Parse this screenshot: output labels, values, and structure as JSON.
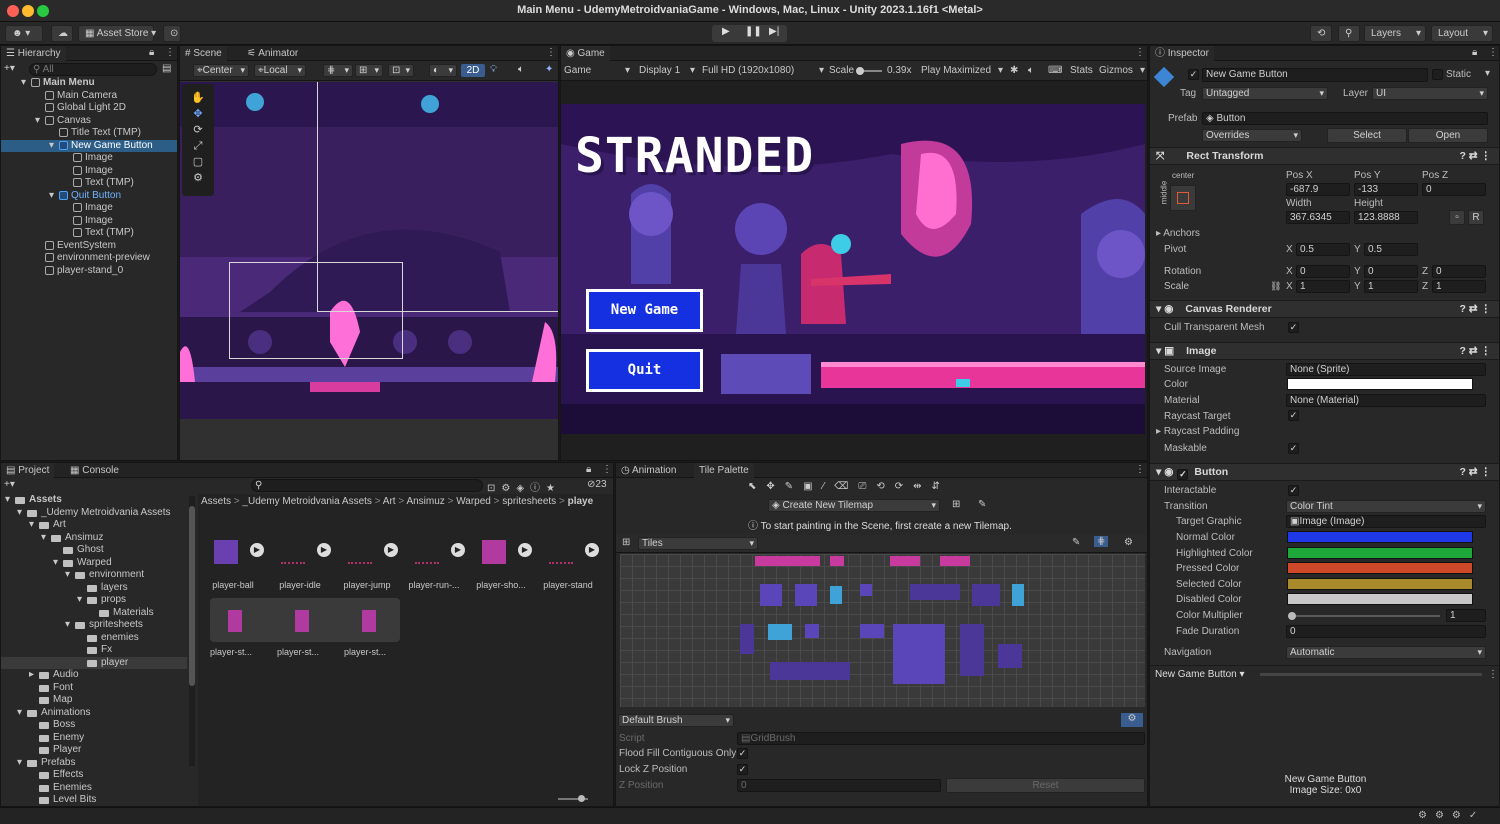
{
  "window": {
    "title": "Main Menu - UdemyMetroidvaniaGame - Windows, Mac, Linux - Unity 2023.1.16f1 <Metal>"
  },
  "toolbar": {
    "asset_store": "Asset Store",
    "layers": "Layers",
    "layout": "Layout"
  },
  "hierarchy": {
    "tab": "Hierarchy",
    "search_placeholder": "All",
    "items": [
      {
        "label": "Main Menu"
      },
      {
        "label": "Main Camera"
      },
      {
        "label": "Global Light 2D"
      },
      {
        "label": "Canvas"
      },
      {
        "label": "Title Text (TMP)"
      },
      {
        "label": "New Game Button"
      },
      {
        "label": "Image"
      },
      {
        "label": "Image"
      },
      {
        "label": "Text (TMP)"
      },
      {
        "label": "Quit Button"
      },
      {
        "label": "Image"
      },
      {
        "label": "Image"
      },
      {
        "label": "Text (TMP)"
      },
      {
        "label": "EventSystem"
      },
      {
        "label": "environment-preview"
      },
      {
        "label": "player-stand_0"
      }
    ]
  },
  "scene": {
    "tabs": [
      "Scene",
      "Animator"
    ],
    "pivot": "Center",
    "space": "Local",
    "mode2d": "2D"
  },
  "game": {
    "tab": "Game",
    "display_dd": "Game",
    "display": "Display 1",
    "resolution": "Full HD (1920x1080)",
    "scale_label": "Scale",
    "scale": "0.39x",
    "play_mode": "Play Maximized",
    "stats": "Stats",
    "gizmos": "Gizmos",
    "title": "STRANDED",
    "new_game": "New Game",
    "quit": "Quit"
  },
  "project": {
    "tabs": [
      "Project",
      "Console"
    ],
    "badge": "23",
    "tree": [
      {
        "label": "Assets"
      },
      {
        "label": "_Udemy Metroidvania Assets"
      },
      {
        "label": "Art"
      },
      {
        "label": "Ansimuz"
      },
      {
        "label": "Ghost"
      },
      {
        "label": "Warped"
      },
      {
        "label": "environment"
      },
      {
        "label": "layers"
      },
      {
        "label": "props"
      },
      {
        "label": "Materials"
      },
      {
        "label": "spritesheets"
      },
      {
        "label": "enemies"
      },
      {
        "label": "Fx"
      },
      {
        "label": "player"
      },
      {
        "label": "Audio"
      },
      {
        "label": "Font"
      },
      {
        "label": "Map"
      },
      {
        "label": "Animations"
      },
      {
        "label": "Boss"
      },
      {
        "label": "Enemy"
      },
      {
        "label": "Player"
      },
      {
        "label": "Prefabs"
      },
      {
        "label": "Effects"
      },
      {
        "label": "Enemies"
      },
      {
        "label": "Level Bits"
      }
    ],
    "breadcrumb": [
      "Assets",
      "_Udemy Metroidvania Assets",
      "Art",
      "Ansimuz",
      "Warped",
      "spritesheets",
      "playe"
    ],
    "assets": [
      "player-ball",
      "player-idle",
      "player-jump",
      "player-run-...",
      "player-sho...",
      "player-stand"
    ],
    "sub_assets": [
      "player-st...",
      "player-st...",
      "player-st..."
    ]
  },
  "palette": {
    "tabs": [
      "Animation",
      "Tile Palette"
    ],
    "create_tilemap": "Create New Tilemap",
    "hint": "To start painting in the Scene, first create a new Tilemap.",
    "tiles_dd": "Tiles",
    "brush": "Default Brush",
    "script_label": "Script",
    "script_value": "GridBrush",
    "flood": "Flood Fill Contiguous Only",
    "lockz": "Lock Z Position",
    "zpos": "Z Position",
    "zpos_value": "0",
    "reset": "Reset"
  },
  "inspector": {
    "tab": "Inspector",
    "object_name": "New Game Button",
    "static": "Static",
    "tag_label": "Tag",
    "tag": "Untagged",
    "layer_label": "Layer",
    "layer": "UI",
    "prefab_label": "Prefab",
    "prefab": "Button",
    "overrides": "Overrides",
    "select": "Select",
    "open": "Open",
    "rect": {
      "title": "Rect Transform",
      "anchor_h": "center",
      "anchor_v": "middle",
      "posx_label": "Pos X",
      "posy_label": "Pos Y",
      "posz_label": "Pos Z",
      "posx": "-687.9",
      "posy": "-133",
      "posz": "0",
      "width_label": "Width",
      "height_label": "Height",
      "width": "367.6345",
      "height": "123.8888",
      "r": "R",
      "anchors": "Anchors",
      "pivot": "Pivot",
      "pivot_x": "0.5",
      "pivot_y": "0.5",
      "rotation": "Rotation",
      "rot_x": "0",
      "rot_y": "0",
      "rot_z": "0",
      "scale": "Scale",
      "scale_x": "1",
      "scale_y": "1",
      "scale_z": "1",
      "x": "X",
      "y": "Y",
      "z": "Z"
    },
    "canvas_renderer": {
      "title": "Canvas Renderer",
      "cull": "Cull Transparent Mesh"
    },
    "image": {
      "title": "Image",
      "source_label": "Source Image",
      "source": "None (Sprite)",
      "color_label": "Color",
      "material_label": "Material",
      "material": "None (Material)",
      "raycast_target": "Raycast Target",
      "raycast_padding": "Raycast Padding",
      "maskable": "Maskable"
    },
    "button": {
      "title": "Button",
      "interactable": "Interactable",
      "transition_label": "Transition",
      "transition": "Color Tint",
      "target_graphic_label": "Target Graphic",
      "target_graphic": "Image (Image)",
      "normal": "Normal Color",
      "highlighted": "Highlighted Color",
      "pressed": "Pressed Color",
      "selected": "Selected Color",
      "disabled": "Disabled Color",
      "multiplier_label": "Color Multiplier",
      "multiplier": "1",
      "fade_label": "Fade Duration",
      "fade": "0",
      "navigation_label": "Navigation",
      "navigation": "Automatic"
    },
    "footer_obj": "New Game Button",
    "preview_name": "New Game Button",
    "preview_size": "Image Size: 0x0",
    "colors": {
      "normal": "#1f39e8",
      "highlighted": "#1ea83a",
      "pressed": "#d0482a",
      "selected": "#a88a2a",
      "disabled": "#c8c8c8"
    }
  }
}
